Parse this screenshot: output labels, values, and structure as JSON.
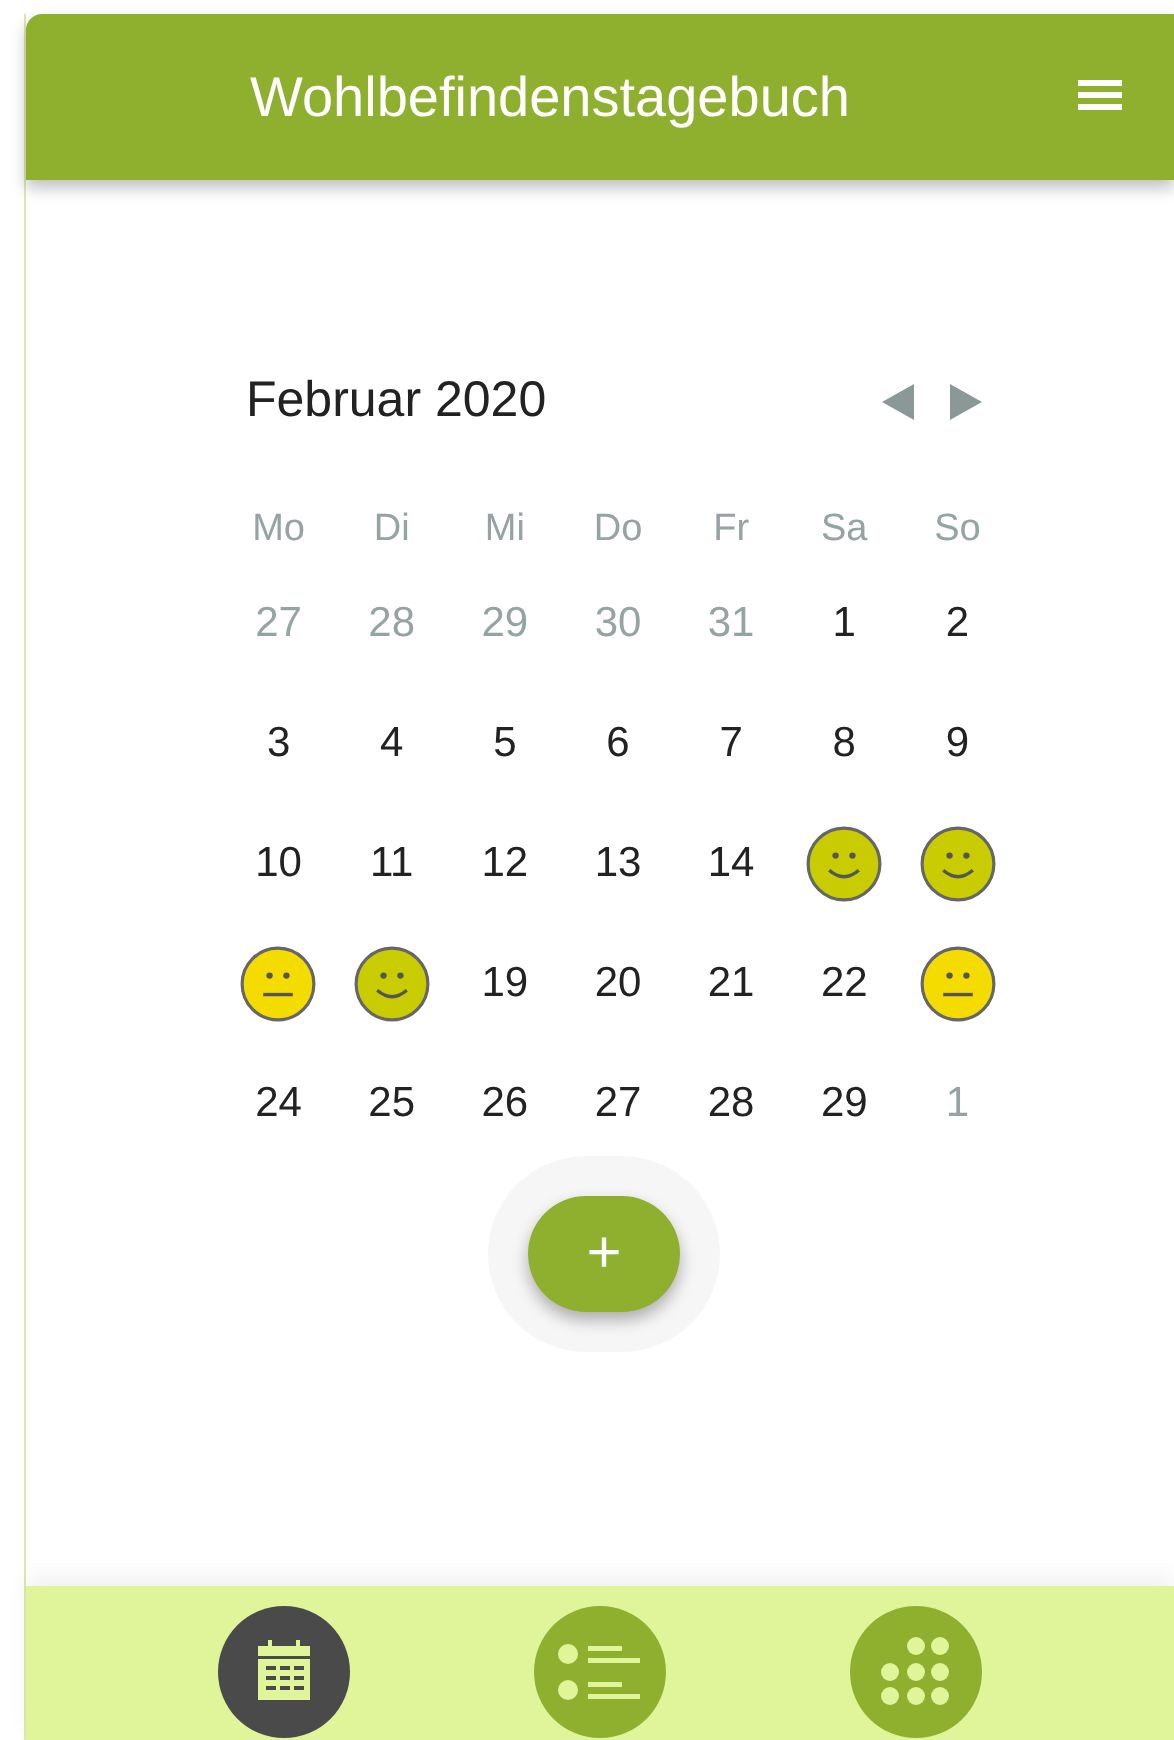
{
  "header": {
    "title": "Wohlbefindenstagebuch"
  },
  "calendar": {
    "month": "Februar 2020",
    "weekdays": [
      "Mo",
      "Di",
      "Mi",
      "Do",
      "Fr",
      "Sa",
      "So"
    ],
    "days": [
      {
        "kind": "day",
        "label": "27",
        "muted": true
      },
      {
        "kind": "day",
        "label": "28",
        "muted": true
      },
      {
        "kind": "day",
        "label": "29",
        "muted": true
      },
      {
        "kind": "day",
        "label": "30",
        "muted": true
      },
      {
        "kind": "day",
        "label": "31",
        "muted": true
      },
      {
        "kind": "day",
        "label": "1",
        "muted": false
      },
      {
        "kind": "day",
        "label": "2",
        "muted": false
      },
      {
        "kind": "day",
        "label": "3",
        "muted": false
      },
      {
        "kind": "day",
        "label": "4",
        "muted": false
      },
      {
        "kind": "day",
        "label": "5",
        "muted": false
      },
      {
        "kind": "day",
        "label": "6",
        "muted": false
      },
      {
        "kind": "day",
        "label": "7",
        "muted": false
      },
      {
        "kind": "day",
        "label": "8",
        "muted": false
      },
      {
        "kind": "day",
        "label": "9",
        "muted": false
      },
      {
        "kind": "day",
        "label": "10",
        "muted": false
      },
      {
        "kind": "day",
        "label": "11",
        "muted": false
      },
      {
        "kind": "day",
        "label": "12",
        "muted": false
      },
      {
        "kind": "day",
        "label": "13",
        "muted": false
      },
      {
        "kind": "day",
        "label": "14",
        "muted": false
      },
      {
        "kind": "happy",
        "color": "#c8cc00"
      },
      {
        "kind": "happy",
        "color": "#c8cc00"
      },
      {
        "kind": "neutral",
        "color": "#f5dc00"
      },
      {
        "kind": "happy",
        "color": "#c8cc00"
      },
      {
        "kind": "day",
        "label": "19",
        "muted": false
      },
      {
        "kind": "day",
        "label": "20",
        "muted": false
      },
      {
        "kind": "day",
        "label": "21",
        "muted": false
      },
      {
        "kind": "day",
        "label": "22",
        "muted": false
      },
      {
        "kind": "neutral",
        "color": "#f5dc00"
      },
      {
        "kind": "day",
        "label": "24",
        "muted": false
      },
      {
        "kind": "day",
        "label": "25",
        "muted": false
      },
      {
        "kind": "day",
        "label": "26",
        "muted": false
      },
      {
        "kind": "day",
        "label": "27",
        "muted": false
      },
      {
        "kind": "day",
        "label": "28",
        "muted": false
      },
      {
        "kind": "day",
        "label": "29",
        "muted": false
      },
      {
        "kind": "day",
        "label": "1",
        "muted": true
      }
    ]
  },
  "add_button": {
    "label": "+"
  },
  "nav": [
    {
      "kind": "calendar",
      "selected": true
    },
    {
      "kind": "list",
      "selected": false
    },
    {
      "kind": "dots",
      "selected": false
    }
  ]
}
